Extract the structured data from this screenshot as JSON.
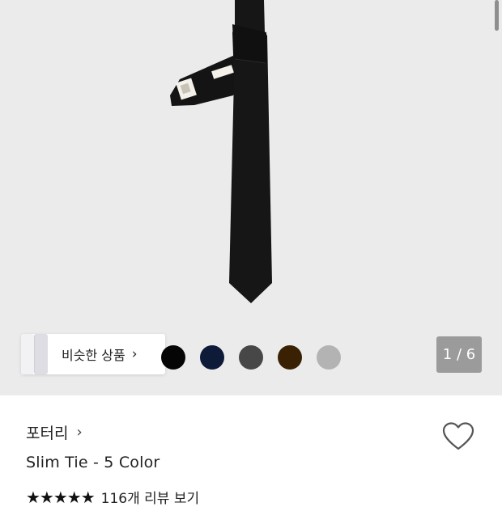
{
  "gallery": {
    "similar_label": "비슷한 상품",
    "chevron": "›",
    "counter": "1 / 6",
    "swatches": [
      {
        "name": "black",
        "color": "#050505"
      },
      {
        "name": "navy",
        "color": "#0d1a38"
      },
      {
        "name": "charcoal",
        "color": "#474747"
      },
      {
        "name": "brown",
        "color": "#3a2103"
      },
      {
        "name": "light-gray",
        "color": "#b3b3b3"
      }
    ]
  },
  "product": {
    "brand": "포터리",
    "brand_chevron": "›",
    "name": "Slim Tie - 5 Color",
    "stars": "★★★★★",
    "rating_value": 5,
    "review_text": "116개 리뷰 보기"
  },
  "icons": [
    "chevron-right-icon",
    "heart-icon",
    "star-icon"
  ]
}
